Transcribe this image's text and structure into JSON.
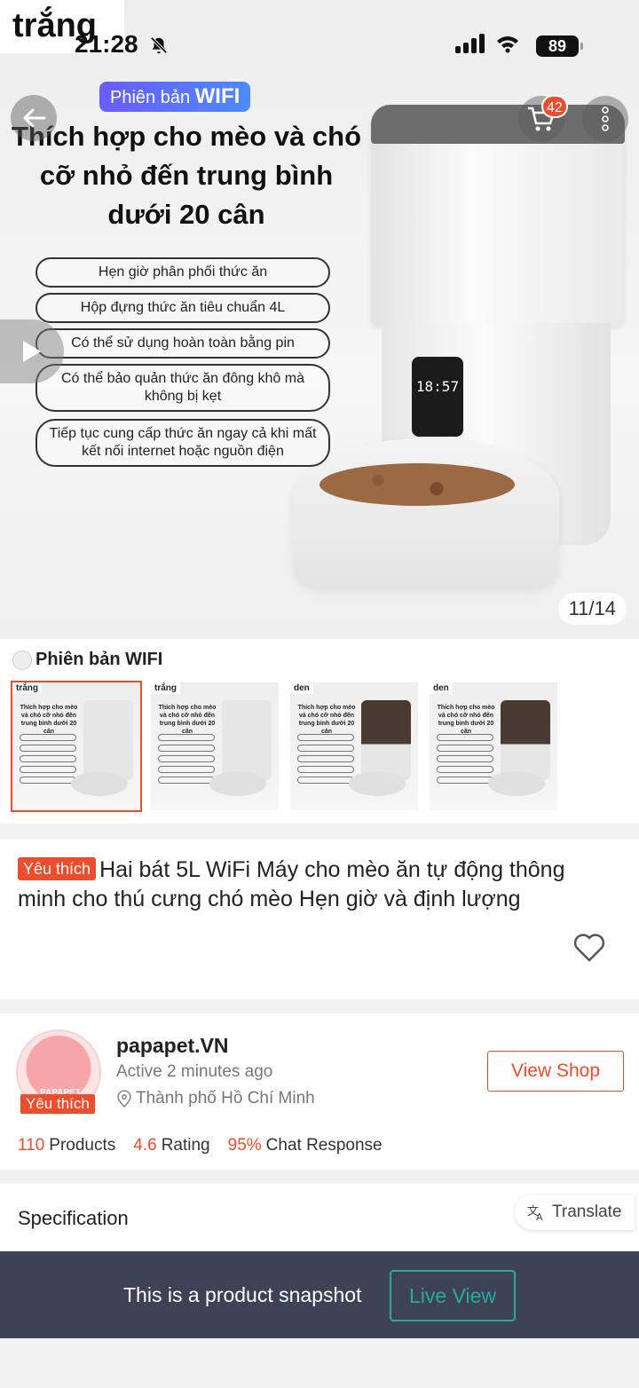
{
  "hero": {
    "variant_tag": "trắng",
    "status_time": "21:28",
    "battery": "89",
    "cart_count": "42",
    "wifi_badge_prefix": "Phiên bản",
    "wifi_badge_emph": "WIFI",
    "headline": "Thích hợp cho mèo và chó cỡ nhỏ đến trung bình dưới 20 cân",
    "features": [
      "Hẹn giờ phân phối thức ăn",
      "Hộp đựng thức ăn tiêu chuẩn 4L",
      "Có thể sử dụng hoàn toàn bằng pin",
      "Có thể bảo quản thức ăn đông khô mà không bị kẹt",
      "Tiếp tục cung cấp thức ăn ngay cả khi mất kết nối internet hoặc nguồn điện"
    ],
    "feeder_display": "18:57",
    "image_counter": "11/14"
  },
  "variations": {
    "title": "Phiên bản WIFI",
    "thumbs": [
      {
        "tag": "trắng",
        "selected": true
      },
      {
        "tag": "trắng",
        "selected": false
      },
      {
        "tag": "den",
        "selected": false
      },
      {
        "tag": "den",
        "selected": false
      }
    ],
    "thumb_caption": "Thích hợp cho mèo và chó cỡ nhỏ đến trung bình dưới 20 cân",
    "thumb_badge": "Phiên bản WIFI"
  },
  "product": {
    "badge": "Yêu thích",
    "title": "Hai bát 5L WiFi Máy cho mèo ăn tự động thông minh cho thú cưng chó mèo Hẹn giờ và định lượng"
  },
  "shop": {
    "avatar_text": "PAPAPET",
    "badge": "Yêu thích",
    "name": "papapet.VN",
    "active": "Active 2 minutes ago",
    "location": "Thành phố Hồ Chí Minh",
    "view_shop": "View Shop",
    "stats": [
      {
        "value": "110",
        "label": "Products"
      },
      {
        "value": "4.6",
        "label": "Rating"
      },
      {
        "value": "95%",
        "label": "Chat Response"
      }
    ]
  },
  "spec": {
    "title": "Specification",
    "translate": "Translate"
  },
  "snapshot": {
    "text": "This is a product snapshot",
    "live_view": "Live View"
  },
  "colors": {
    "accent": "#ee4d2d",
    "teal": "#26aa99",
    "snapshot_bg": "#3d4256"
  }
}
